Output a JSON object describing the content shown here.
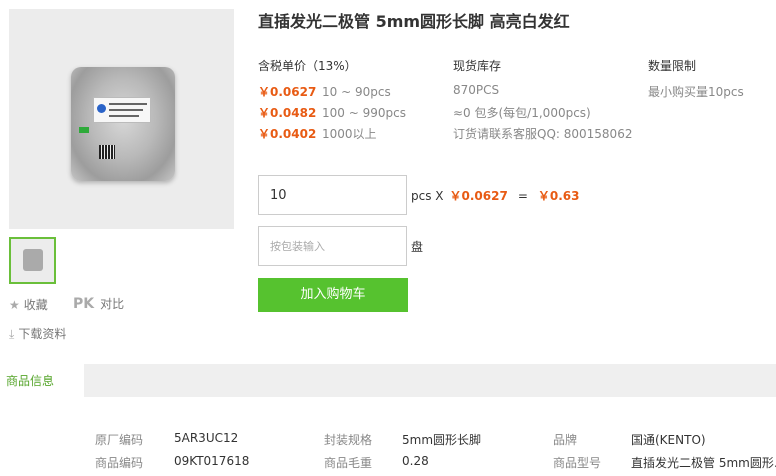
{
  "product": {
    "title": "直插发光二极管 5mm圆形长脚 高亮白发红"
  },
  "sidebar": {
    "favorite_label": "收藏",
    "compare_prefix": "PK",
    "compare_label": "对比",
    "download_label": "下载资料"
  },
  "pricing": {
    "header": "含税单价（13%）",
    "tiers": [
      {
        "price": "￥0.0627",
        "range": "10 ~ 90pcs"
      },
      {
        "price": "￥0.0482",
        "range": "100 ~ 990pcs"
      },
      {
        "price": "￥0.0402",
        "range": "1000以上"
      }
    ]
  },
  "stock": {
    "header": "现货库存",
    "quantity": "870PCS",
    "package": "≈0 包多(每包/1,000pcs)",
    "contact": "订货请联系客服QQ: 800158062"
  },
  "limit": {
    "header": "数量限制",
    "value": "最小购买量10pcs"
  },
  "order": {
    "quantity_value": "10",
    "unit_text": "pcs X",
    "unit_price": "￥0.0627",
    "equals": "=",
    "total": "￥0.63",
    "pack_placeholder": "按包装输入",
    "pack_unit": "盘",
    "add_to_cart_label": "加入购物车"
  },
  "tabs": {
    "info_label": "商品信息"
  },
  "specs": [
    {
      "key": "原厂编码",
      "value": "5AR3UC12"
    },
    {
      "key": "封装规格",
      "value": "5mm圆形长脚"
    },
    {
      "key": "品牌",
      "value": "国通(KENTO)"
    },
    {
      "key": "商品编码",
      "value": "09KT017618"
    },
    {
      "key": "商品毛重",
      "value": "0.28"
    },
    {
      "key": "商品型号",
      "value": "直插发光二极管 5mm圆形…"
    }
  ],
  "colors": {
    "price": "#e85b14",
    "accent_green": "#56c22f"
  },
  "icons": [
    "star-icon",
    "download-icon"
  ]
}
